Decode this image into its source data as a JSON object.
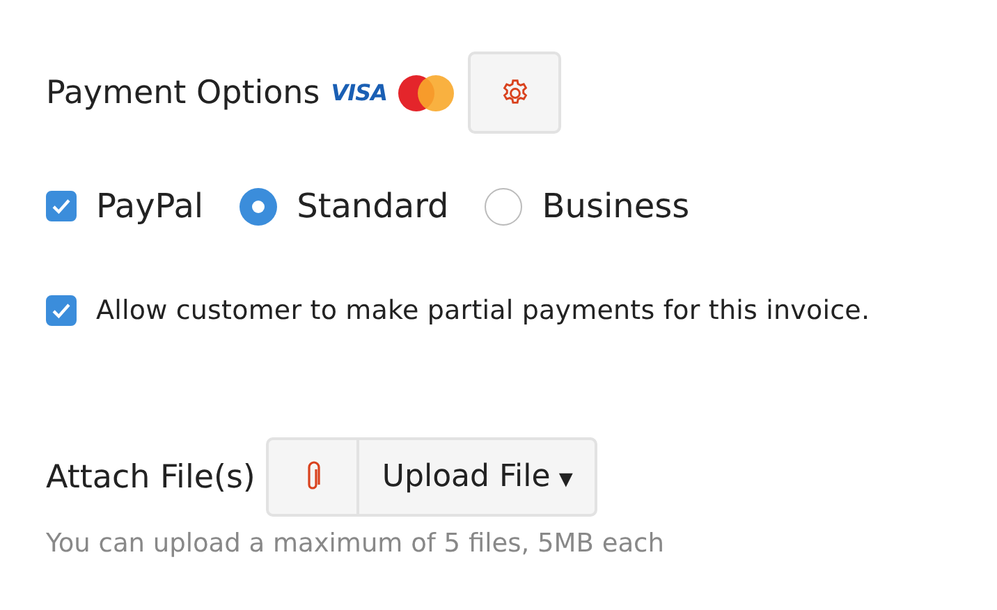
{
  "payment_options": {
    "label": "Payment Options",
    "visa_logo": "VISA"
  },
  "gateways": [
    {
      "kind": "checkbox",
      "label": "PayPal",
      "checked": true
    },
    {
      "kind": "radio",
      "label": "Standard",
      "selected": true
    },
    {
      "kind": "radio",
      "label": "Business",
      "selected": false
    }
  ],
  "partial_payments": {
    "label": "Allow customer to make partial payments for this invoice.",
    "checked": true
  },
  "attachments": {
    "label": "Attach File(s)",
    "upload_button": "Upload File",
    "caret": "▾",
    "hint": "You can upload a maximum of 5 files, 5MB each"
  }
}
